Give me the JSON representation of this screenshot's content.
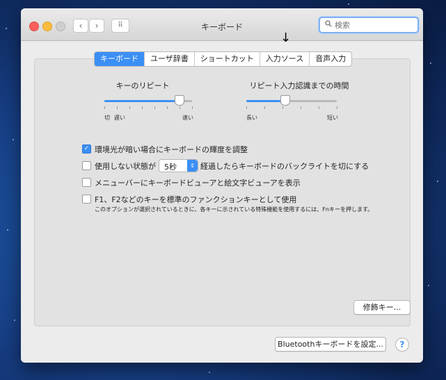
{
  "window": {
    "title": "キーボード"
  },
  "toolbar": {
    "back_icon": "‹",
    "forward_icon": "›",
    "grid_icon": "⠿"
  },
  "search": {
    "placeholder": "検索"
  },
  "annotation": {
    "arrow": "↓"
  },
  "tabs": [
    {
      "label": "キーボード",
      "active": true
    },
    {
      "label": "ユーザ辞書"
    },
    {
      "label": "ショートカット"
    },
    {
      "label": "入力ソース"
    },
    {
      "label": "音声入力"
    }
  ],
  "key_repeat": {
    "title": "キーのリピート",
    "left_label": "切",
    "left_label2": "遅い",
    "right_label": "速い",
    "level": 0.85
  },
  "delay_until_repeat": {
    "title": "リピート入力認識までの時間",
    "left_label": "長い",
    "right_label": "短い",
    "level": 0.42
  },
  "options": [
    {
      "label": "環境光が暗い場合にキーボードの輝度を調整",
      "checked": true
    },
    {
      "label_before": "使用しない状態が",
      "label_after": "経過したらキーボードのバックライトを切にする",
      "checked": false
    },
    {
      "label": "メニューバーにキーボードビューアと絵文字ビューアを表示",
      "checked": false
    },
    {
      "label": "F1、F2などのキーを標準のファンクションキーとして使用",
      "checked": false
    }
  ],
  "backlight_timeout": {
    "value": "5秒"
  },
  "fn_note": "このオプションが選択されているときに、各キーに示されている特殊機能を使用するには、Fnキーを押します。",
  "buttons": {
    "modifier_keys": "修飾キー...",
    "bluetooth_setup": "Bluetoothキーボードを設定...",
    "help": "?"
  },
  "colors": {
    "accent": "#3b8ff5"
  }
}
